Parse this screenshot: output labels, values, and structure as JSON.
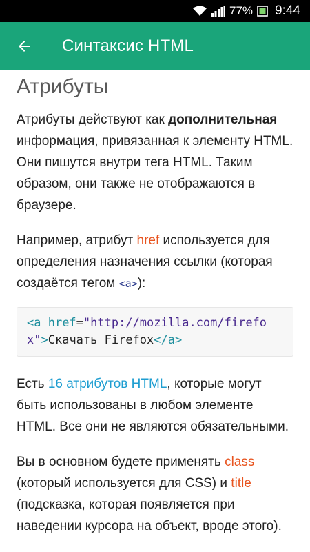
{
  "status_bar": {
    "battery_percent": "77%",
    "time": "9:44"
  },
  "app_bar": {
    "title": "Синтаксис HTML"
  },
  "content": {
    "section_title": "Атрибуты",
    "p1": {
      "before_bold": "Атрибуты действуют как ",
      "bold": "дополнительная",
      "after_bold": " информация, привязанная к элементу HTML. Они пишутся внутри тега HTML. Таким образом, они также не отображаются в браузере."
    },
    "p2": {
      "before": "Например, атрибут ",
      "keyword": "href",
      "middle": " используется для определения назначения ссылки (которая создаётся тегом ",
      "code": "<a>",
      "after": "):"
    },
    "code_block": {
      "open_tag": "<a",
      "attr": " href",
      "eq": "=",
      "value": "\"http://mozilla.com/firefox\"",
      "close_bracket": ">",
      "text": "Скачать Firefox",
      "end_tag": "</a>"
    },
    "p3": {
      "before": "Есть ",
      "link": "16 атрибутов HTML",
      "after": ", которые могут быть использованы в любом элементе HTML. Все они не являются обязательными."
    },
    "p4": {
      "before": "Вы в основном будете применять ",
      "kw1": "class",
      "middle": " (который используется для CSS) и ",
      "kw2": "title",
      "after": " (подсказка, которая появляется при наведении курсора на объект, вроде этого)."
    }
  },
  "colors": {
    "app_bar": "#1aa57a",
    "keyword": "#e8541f",
    "link": "#1f9ed1"
  }
}
